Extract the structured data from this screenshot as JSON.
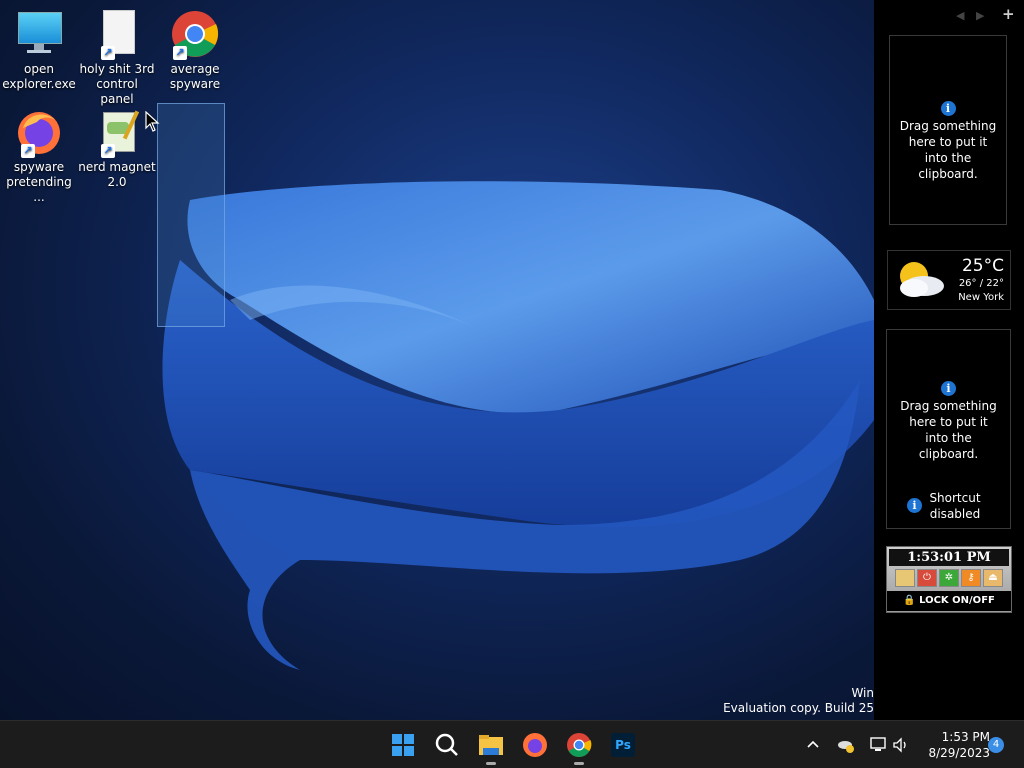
{
  "desktop": {
    "icons": [
      {
        "label": "open explorer.exe",
        "icon": "monitor-icon"
      },
      {
        "label": "holy shit 3rd control panel",
        "icon": "blank-file-icon"
      },
      {
        "label": "average spyware",
        "icon": "chrome-icon"
      },
      {
        "label": "spyware pretending ...",
        "icon": "firefox-icon"
      },
      {
        "label": "nerd magnet 2.0",
        "icon": "notepad-icon"
      }
    ],
    "watermark": {
      "line1": "Win",
      "line2": "Evaluation copy. Build 25"
    }
  },
  "sidebar": {
    "nav_prev": "◀",
    "nav_next": "▶",
    "nav_add": "+",
    "clipboard1": {
      "message": "Drag something here to put it into the clipboard."
    },
    "weather": {
      "temp": "25°C",
      "range": "26° / 22°",
      "city": "New York",
      "icon": "sun-cloud-icon"
    },
    "clipboard2": {
      "message": "Drag something here to put it into the clipboard.",
      "shortcut": "Shortcut disabled"
    },
    "clock": {
      "time": "1:53:01 PM",
      "lock_label": "LOCK ON/OFF"
    }
  },
  "taskbar": {
    "apps": [
      "start-icon",
      "search-icon",
      "file-explorer-icon",
      "firefox-icon",
      "chrome-icon",
      "photoshop-icon"
    ],
    "photoshop_label": "Ps",
    "tray": {
      "chevron": "^",
      "time": "1:53 PM",
      "date": "8/29/2023",
      "notifications": "4"
    }
  },
  "colors": {
    "accent": "#1e74d2",
    "taskbar": "#1c1c1c",
    "sidebar": "#000000"
  }
}
